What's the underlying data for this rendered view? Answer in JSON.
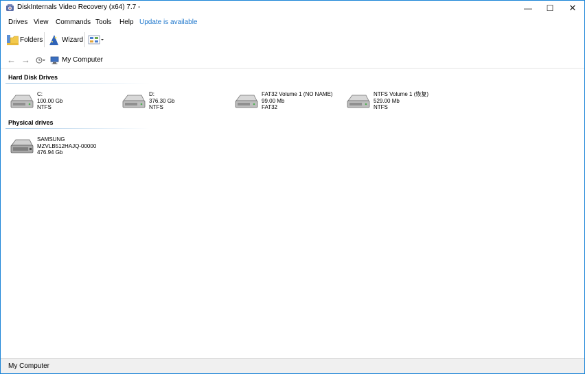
{
  "window": {
    "title": "DiskInternals Video Recovery (x64) 7.7 -",
    "min_glyph": "—",
    "max_glyph": "☐",
    "close_glyph": "✕"
  },
  "menu": {
    "items": [
      "Drives",
      "View",
      "Commands",
      "Tools",
      "Help"
    ],
    "update_link": "Update is available"
  },
  "toolbar": {
    "folders_label": "Folders",
    "wizard_label": "Wizard",
    "view_icon": "view-mode-icon"
  },
  "nav": {
    "back_glyph": "←",
    "forward_glyph": "→",
    "location": "My Computer"
  },
  "sections": {
    "hard_disk": "Hard Disk Drives",
    "physical": "Physical drives"
  },
  "hard_drives": [
    {
      "name": "C:",
      "size": "100.00 Gb",
      "fs": "NTFS"
    },
    {
      "name": "D:",
      "size": "376.30 Gb",
      "fs": "NTFS"
    },
    {
      "name": "FAT32 Volume 1 (NO NAME)",
      "size": "99.00 Mb",
      "fs": "FAT32"
    },
    {
      "name": "NTFS Volume 1 (恢复)",
      "size": "529.00 Mb",
      "fs": "NTFS"
    }
  ],
  "physical_drives": [
    {
      "name": "SAMSUNG",
      "model": "MZVLB512HAJQ-00000",
      "size": "476.94 Gb"
    }
  ],
  "status": {
    "text": "My Computer"
  },
  "colors": {
    "accent": "#1883d7",
    "link": "#1e77cc"
  }
}
